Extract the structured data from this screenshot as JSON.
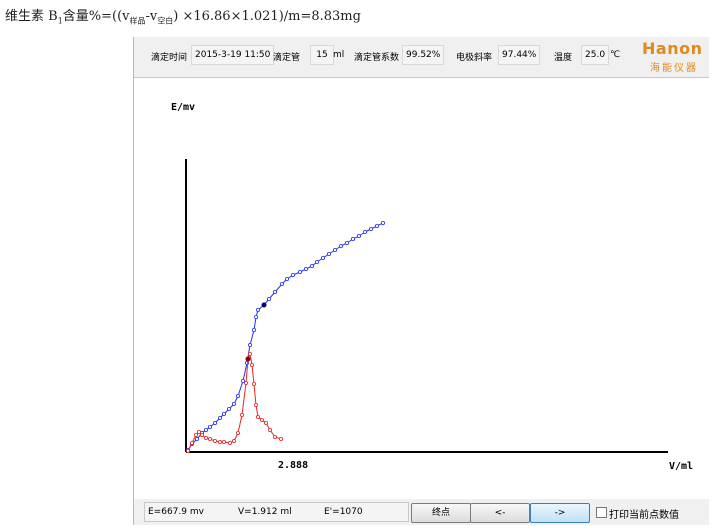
{
  "formula": {
    "prefix": "维生素 B",
    "sub1": "1",
    "mid1": "含量%=((v",
    "sub2": "样品",
    "mid2": "-v",
    "sub3": "空白",
    "suffix": ") ×16.86×1.021)/m=8.83mg"
  },
  "toolbar": {
    "time_label": "滴定时间",
    "time_value": "2015-3-19 11:50",
    "tube_label": "滴定管",
    "tube_value": "15",
    "tube_unit": "ml",
    "coef_label": "滴定管系数",
    "coef_value": "99.52%",
    "slope_label": "电极斜率",
    "slope_value": "97.44%",
    "temp_label": "温度",
    "temp_value": "25.0",
    "temp_unit": "℃"
  },
  "logo": {
    "brand": "Hanon",
    "cn": "海能仪器"
  },
  "plot": {
    "y_axis_label": "E/mv",
    "x_axis_label": "V/ml",
    "endpoint_label": "2.888"
  },
  "status": {
    "e_readout": "E=667.9 mv",
    "v_readout": "V=1.912 ml",
    "deriv_readout": "E'=1070"
  },
  "buttons": {
    "endpoint": "终点",
    "prev": "<-",
    "next": "->"
  },
  "print_checkbox_label": "打印当前点数值",
  "colors": {
    "potential_curve": "#2030ff",
    "derivative_curve": "#ee2222",
    "logo": "#e08a1e"
  }
}
